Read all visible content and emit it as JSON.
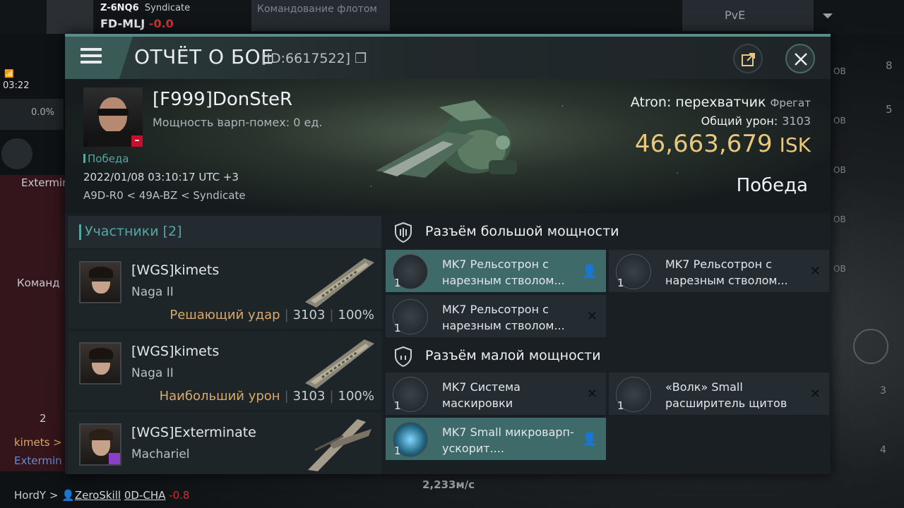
{
  "background": {
    "system_security_label": "Z-6NQ6",
    "alliance_label": "Syndicate",
    "system_name": "FD-MLJ",
    "system_sec": "-0.0",
    "fleet_button": "Командование флотом",
    "mode_selector": "PvE",
    "clock": "03:22",
    "cargo_percent": "0.0%",
    "side_texts": [
      "Extermin",
      "Команд",
      "kimets >",
      "Extermin",
      "2"
    ],
    "right_rows": [
      "8",
      "ОВ",
      "5",
      "ОВ",
      "ОВ",
      "ОВ",
      "ОВ",
      "3",
      "4"
    ],
    "speed": "2,233м/с",
    "pilot_line": {
      "prefix": "HordY",
      "name": "ZeroSkill",
      "location": "0D-CHA",
      "sec": "-0.8"
    }
  },
  "window": {
    "title": "ОТЧЁТ О БОЕ",
    "report_id": "[ID:6617522]"
  },
  "victim": {
    "name": "[F999]DonSteR",
    "warp_disrupt": "Мощность варп-помех: 0 ед.",
    "result_tag": "Победа",
    "datetime": "2022/01/08 03:10:17 UTC +3",
    "location": "A9D-R0 < 49A-BZ < Syndicate",
    "ship": "Atron: перехватчик",
    "ship_class": "Фрегат",
    "total_damage_label": "Общий урон:",
    "total_damage": "3103",
    "isk_value": "46,663,679",
    "isk_unit": "ISK",
    "outcome": "Победа"
  },
  "participants": {
    "header": "Участники [2]",
    "rows": [
      {
        "name": "[WGS]kimets",
        "ship": "Naga II",
        "label": "Решающий удар",
        "damage": "3103",
        "percent": "100%"
      },
      {
        "name": "[WGS]kimets",
        "ship": "Naga II",
        "label": "Наибольший урон",
        "damage": "3103",
        "percent": "100%"
      },
      {
        "name": "[WGS]Exterminate",
        "ship": "Machariel",
        "label": "",
        "damage": "",
        "percent": ""
      }
    ]
  },
  "fittings": {
    "high_slot_title": "Разъём большой мощности",
    "low_slot_title": "Разъём малой мощности",
    "high": [
      {
        "name": "MK7 Рельсотрон с нарезным стволом...",
        "qty": "1",
        "state": "pilot"
      },
      {
        "name": "MK7 Рельсотрон с нарезным стволом...",
        "qty": "1",
        "state": "destroyed"
      },
      {
        "name": "MK7 Рельсотрон с нарезным стволом...",
        "qty": "1",
        "state": "destroyed"
      }
    ],
    "low": [
      {
        "name": "MK7 Система маскировки",
        "qty": "1",
        "state": "destroyed"
      },
      {
        "name": "«Волк» Small расширитель щитов",
        "qty": "1",
        "state": "destroyed"
      },
      {
        "name": "MK7 Small микроварп-ускорит....",
        "qty": "1",
        "state": "pilot"
      }
    ],
    "state_glyphs": {
      "destroyed": "✕",
      "pilot": "👤"
    }
  },
  "colors": {
    "accent_teal": "#58a6a0",
    "isk_gold": "#e9c77c",
    "highlight_row": "#3f6a6a",
    "label_orange": "#d8a96a"
  }
}
